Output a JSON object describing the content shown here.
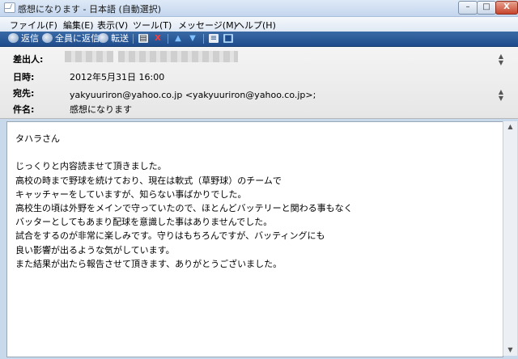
{
  "window": {
    "title": "感想になります - 日本語 (自動選択)",
    "controls": {
      "min": "–",
      "max": "□",
      "close": "X"
    }
  },
  "menu": [
    "ファイル(F)",
    "編集(E)",
    "表示(V)",
    "ツール(T)",
    "メッセージ(M)",
    "ヘルプ(H)"
  ],
  "toolbar": {
    "reply": "返信",
    "reply_all": "全員に返信",
    "forward": "転送",
    "delete_glyph": "X"
  },
  "header": {
    "from_label": "差出人:",
    "date_label": "日時:",
    "date_value": "2012年5月31日 16:00",
    "to_label": "宛先:",
    "to_value": "yakyuuriron@yahoo.co.jp <yakyuuriron@yahoo.co.jp>;",
    "subject_label": "件名:",
    "subject_value": "感想になります"
  },
  "body": {
    "lines": [
      "タハラさん",
      "",
      "じっくりと内容読ませて頂きました。",
      "高校の時まで野球を続けており、現在は軟式（草野球）のチームで",
      "キャッチャーをしていますが、知らない事ばかりでした。",
      "高校生の頃は外野をメインで守っていたので、ほとんどバッテリーと関わる事もなく",
      "バッターとしてもあまり配球を意識した事はありませんでした。",
      "試合をするのが非常に楽しみです。守りはもちろんですが、バッティングにも",
      "良い影響が出るような気がしています。",
      "また結果が出たら報告させて頂きます、ありがとうございました。"
    ]
  }
}
